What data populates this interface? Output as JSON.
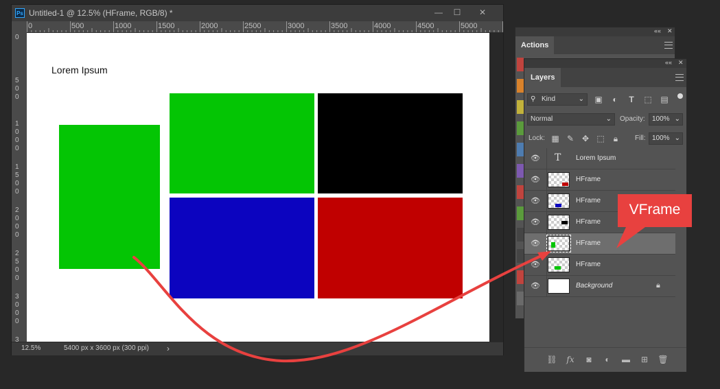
{
  "document": {
    "title": "Untitled-1 @ 12.5% (HFrame, RGB/8) *",
    "app_icon": "Ps",
    "zoom": "12.5%",
    "dimensions": "5400 px x 3600 px (300 ppi)",
    "status_arrow": "›",
    "canvas_text": "Lorem Ipsum",
    "ruler_top": [
      "0",
      "500",
      "1000",
      "1500",
      "2000",
      "2500",
      "3000",
      "3500",
      "4000",
      "4500",
      "5000"
    ],
    "ruler_left": [
      "0",
      "500",
      "1000",
      "1500",
      "2000",
      "2500",
      "3000",
      "3"
    ],
    "colors": {
      "green": "#04c504",
      "black": "#000000",
      "blue": "#0c04bf",
      "red": "#c00000"
    }
  },
  "window_controls": {
    "minimize": "—",
    "maximize": "☐",
    "close": "✕"
  },
  "actions_panel": {
    "collapse": "««",
    "close": "✕",
    "tab": "Actions",
    "swatches": [
      "#c0443e",
      "#d9822b",
      "#c2b23b",
      "#5b9b3c",
      "#4e7cb0",
      "#7d59b0",
      "#c0443e",
      "#5b9b3c",
      "#454545",
      "#454545",
      "#c0443e",
      "#6a6a6a"
    ]
  },
  "layers_panel": {
    "collapse": "««",
    "close": "✕",
    "tab": "Layers",
    "filter_kind": "Kind",
    "blend_mode": "Normal",
    "opacity_label": "Opacity:",
    "opacity_value": "100%",
    "lock_label": "Lock:",
    "fill_label": "Fill:",
    "fill_value": "100%",
    "layers": [
      {
        "name": "Lorem Ipsum",
        "type": "text",
        "selected": false,
        "mini_color": ""
      },
      {
        "name": "HFrame",
        "type": "frame",
        "selected": false,
        "mini_color": "#c00000"
      },
      {
        "name": "HFrame",
        "type": "frame",
        "selected": false,
        "mini_color": "#0c04bf"
      },
      {
        "name": "HFrame",
        "type": "frame",
        "selected": false,
        "mini_color": "#000000"
      },
      {
        "name": "HFrame",
        "type": "frame",
        "selected": true,
        "mini_color": "#04c504"
      },
      {
        "name": "HFrame",
        "type": "frame",
        "selected": false,
        "mini_color": "#04c504"
      },
      {
        "name": "Background",
        "type": "background",
        "selected": false,
        "mini_color": ""
      }
    ],
    "footer_icons": [
      "link-icon",
      "fx-icon",
      "mask-icon",
      "adjustment-icon",
      "folder-icon",
      "new-layer-icon",
      "trash-icon"
    ]
  },
  "annotation": {
    "callout_text": "VFrame",
    "color": "#e8413f"
  }
}
